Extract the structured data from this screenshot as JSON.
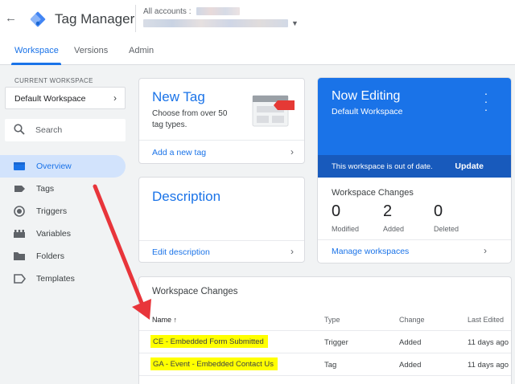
{
  "header": {
    "back_glyph": "←",
    "app_title": "Tag Manager",
    "account_label": "All accounts :"
  },
  "tabs": [
    {
      "label": "Workspace",
      "active": true
    },
    {
      "label": "Versions",
      "active": false
    },
    {
      "label": "Admin",
      "active": false
    }
  ],
  "sidebar": {
    "current_workspace_label": "CURRENT WORKSPACE",
    "workspace_selector": "Default Workspace",
    "search_placeholder": "Search",
    "items": [
      {
        "label": "Overview",
        "icon": "overview-icon",
        "active": true
      },
      {
        "label": "Tags",
        "icon": "tag-icon",
        "active": false
      },
      {
        "label": "Triggers",
        "icon": "trigger-icon",
        "active": false
      },
      {
        "label": "Variables",
        "icon": "variables-icon",
        "active": false
      },
      {
        "label": "Folders",
        "icon": "folder-icon",
        "active": false
      },
      {
        "label": "Templates",
        "icon": "template-icon",
        "active": false
      }
    ]
  },
  "new_tag_card": {
    "title": "New Tag",
    "subtitle": "Choose from over 50 tag types.",
    "link": "Add a new tag"
  },
  "description_card": {
    "title": "Description",
    "link": "Edit description"
  },
  "now_editing_card": {
    "title": "Now Editing",
    "workspace": "Default Workspace",
    "status": "This workspace is out of date.",
    "update_label": "Update",
    "changes_heading": "Workspace Changes",
    "stats": [
      {
        "value": "0",
        "label": "Modified"
      },
      {
        "value": "2",
        "label": "Added"
      },
      {
        "value": "0",
        "label": "Deleted"
      }
    ],
    "link": "Manage workspaces"
  },
  "workspace_changes": {
    "title": "Workspace Changes",
    "columns": {
      "name": "Name",
      "type": "Type",
      "change": "Change",
      "last_edited": "Last Edited"
    },
    "rows": [
      {
        "name": "CE - Embedded Form Submitted",
        "type": "Trigger",
        "change": "Added",
        "last_edited": "11 days ago"
      },
      {
        "name": "GA - Event - Embedded Contact Us",
        "type": "Tag",
        "change": "Added",
        "last_edited": "11 days ago"
      }
    ]
  },
  "colors": {
    "accent": "#1a73e8",
    "highlight": "#ffff00",
    "annotation_arrow": "#e8353b"
  }
}
